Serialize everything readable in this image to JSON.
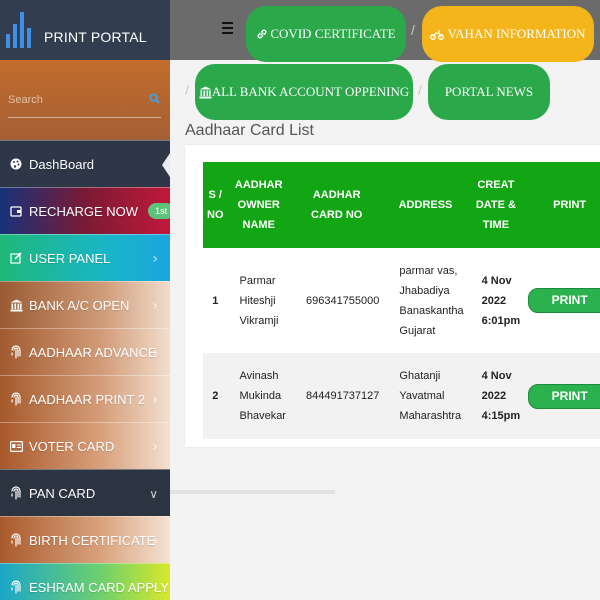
{
  "brand": {
    "title": "PRINT PORTAL",
    "logo_icon": "bar-chart-icon",
    "logo_color": "#3d8fe8"
  },
  "search": {
    "placeholder": "Search"
  },
  "sidebar": {
    "items": [
      {
        "label": "DashBoard",
        "icon": "palette-icon"
      },
      {
        "label": "RECHARGE NOW",
        "icon": "wallet-icon",
        "badge": "1st"
      },
      {
        "label": "USER PANEL",
        "icon": "edit-icon"
      },
      {
        "label": "BANK A/C OPEN",
        "icon": "bank-icon"
      },
      {
        "label": "AADHAAR ADVANCE",
        "icon": "fingerprint-icon"
      },
      {
        "label": "AADHAAR PRINT 2",
        "icon": "fingerprint-icon"
      },
      {
        "label": "VOTER CARD",
        "icon": "id-card-icon"
      },
      {
        "label": "PAN CARD",
        "icon": "fingerprint-icon"
      },
      {
        "label": "BIRTH CERTIFICATE",
        "icon": "fingerprint-icon"
      },
      {
        "label": "ESHRAM CARD APPLY",
        "icon": "fingerprint-icon"
      }
    ]
  },
  "topbar": {
    "covid_label": "COVID CERTIFICATE",
    "vahan_label": "VAHAN INFORMATION",
    "bank_label": "ALL BANK ACCOUNT OPPENING",
    "news_label": "PORTAL NEWS",
    "separator": "/",
    "colors": {
      "green": "#2aa84a",
      "yellow": "#f4b51a",
      "bar": "#6b6b6b"
    }
  },
  "page": {
    "title": "Aadhaar Card List"
  },
  "table": {
    "headers": {
      "sno": [
        "S /",
        "NO"
      ],
      "name": [
        "AADHAR",
        "OWNER",
        "NAME"
      ],
      "card": [
        "AADHAR",
        "CARD NO"
      ],
      "address": "ADDRESS",
      "date": [
        "CREAT",
        "DATE &",
        "TIME"
      ],
      "print": "PRINT"
    },
    "rows": [
      {
        "sno": "1",
        "name": [
          "Parmar",
          "Hiteshji",
          "Vikramji"
        ],
        "card_no": "696341755000",
        "address": [
          "parmar vas,",
          "Jhabadiya",
          "Banaskantha",
          "Gujarat"
        ],
        "date": [
          "4 Nov",
          "2022",
          "6:01pm"
        ],
        "print_label": "PRINT"
      },
      {
        "sno": "2",
        "name": [
          "Avinash",
          "Mukinda",
          "Bhavekar"
        ],
        "card_no": "844491737127",
        "address": [
          "Ghatanji",
          "Yavatmal",
          "Maharashtra"
        ],
        "date": [
          "4 Nov",
          "2022",
          "4:15pm"
        ],
        "print_label": "PRINT"
      }
    ],
    "header_color": "#12a514"
  }
}
